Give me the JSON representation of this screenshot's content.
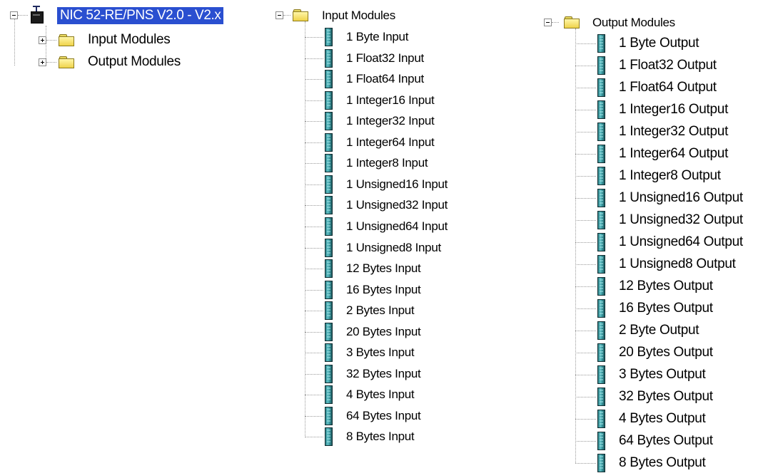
{
  "device_tree": {
    "root_label": "NIC 52-RE/PNS V2.0 - V2.x",
    "children": [
      "Input Modules",
      "Output Modules"
    ]
  },
  "input_modules": {
    "header": "Input Modules",
    "items": [
      "1 Byte Input",
      "1 Float32 Input",
      "1 Float64 Input",
      "1 Integer16 Input",
      "1 Integer32 Input",
      "1 Integer64 Input",
      "1 Integer8 Input",
      "1 Unsigned16 Input",
      "1 Unsigned32 Input",
      "1 Unsigned64 Input",
      "1 Unsigned8 Input",
      "12 Bytes Input",
      "16 Bytes Input",
      "2 Bytes Input",
      "20 Bytes Input",
      "3 Bytes Input",
      "32 Bytes Input",
      "4 Bytes Input",
      "64 Bytes Input",
      "8 Bytes Input"
    ]
  },
  "output_modules": {
    "header": "Output Modules",
    "items": [
      "1 Byte Output",
      "1 Float32 Output",
      "1 Float64 Output",
      "1 Integer16 Output",
      "1 Integer32 Output",
      "1 Integer64 Output",
      "1 Integer8 Output",
      "1 Unsigned16 Output",
      "1 Unsigned32 Output",
      "1 Unsigned64 Output",
      "1 Unsigned8 Output",
      "12 Bytes Output",
      "16 Bytes Output",
      "2 Byte Output",
      "20 Bytes Output",
      "3 Bytes Output",
      "32 Bytes Output",
      "4 Bytes Output",
      "64 Bytes Output",
      "8 Bytes Output"
    ]
  },
  "icons": {
    "device": "network-device-icon",
    "folder": "folder-icon",
    "module": "module-icon",
    "collapse": "collapse-box-icon",
    "expand": "expand-box-icon"
  },
  "colors": {
    "selection_bg": "#2a4fd0",
    "module_teal": "#3c9aa1",
    "folder_yellow": "#efd34a"
  }
}
